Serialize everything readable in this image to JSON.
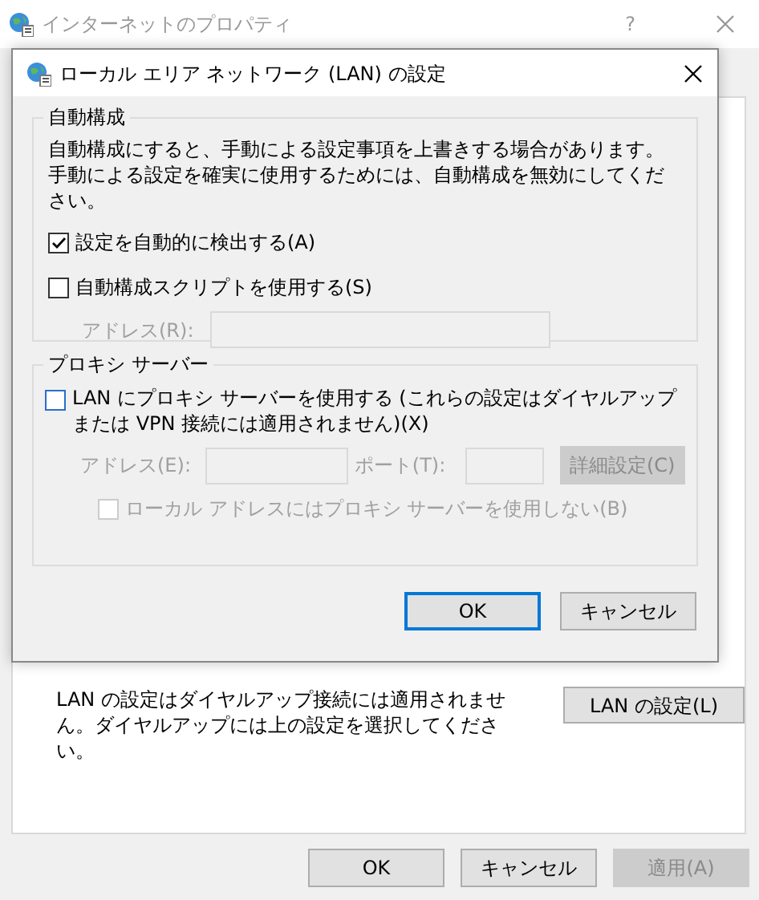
{
  "window": {
    "title": "インターネットのプロパティ",
    "help": "?"
  },
  "lan_section": {
    "description": "LAN の設定はダイヤルアップ接続には適用されません。ダイヤルアップには上の設定を選択してください。",
    "button": "LAN の設定(L)"
  },
  "buttons": [
    {
      "label": "OK",
      "disabled": false
    },
    {
      "label": "キャンセル",
      "disabled": false
    },
    {
      "label": "適用(A)",
      "disabled": true
    }
  ],
  "dialog": {
    "title": "ローカル エリア ネットワーク (LAN) の設定",
    "auto_config": {
      "legend": "自動構成",
      "description": "自動構成にすると、手動による設定事項を上書きする場合があります。手動による設定を確実に使用するためには、自動構成を無効にしてください。",
      "options": [
        {
          "label": "設定を自動的に検出する(A)",
          "checked": true
        },
        {
          "label": "自動構成スクリプトを使用する(S)",
          "checked": false
        }
      ],
      "address": {
        "label": "アドレス(R):",
        "disabled": true
      }
    },
    "proxy": {
      "legend": "プロキシ サーバー",
      "use_proxy": {
        "label": "LAN にプロキシ サーバーを使用する (これらの設定はダイヤルアップまたは VPN 接続には適用されません)(X)",
        "checked": false
      },
      "address": {
        "label": "アドレス(E):",
        "disabled": true
      },
      "port": {
        "label": "ポート(T):",
        "disabled": true
      },
      "advanced_button": {
        "label": "詳細設定(C)",
        "disabled": true
      },
      "bypass_local": {
        "label": "ローカル アドレスにはプロキシ サーバーを使用しない(B)",
        "checked": false,
        "disabled": true
      }
    },
    "buttons": [
      {
        "label": "OK",
        "default": true
      },
      {
        "label": "キャンセル",
        "default": false
      }
    ]
  }
}
